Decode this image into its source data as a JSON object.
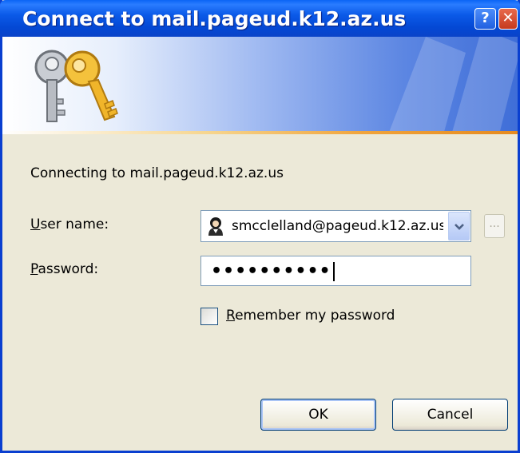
{
  "window": {
    "title": "Connect to mail.pageud.k12.az.us",
    "help_button": "?",
    "close_button": "✕"
  },
  "dialog": {
    "connecting_text": "Connecting to mail.pageud.k12.az.us",
    "user_name": {
      "label_access_key": "U",
      "label_rest": "ser name:",
      "value": "smcclelland@pageud.k12.az.us"
    },
    "password": {
      "label_access_key": "P",
      "label_rest": "assword:",
      "masked_value": "••••••••••"
    },
    "browse_button": "...",
    "remember": {
      "label_access_key": "R",
      "label_rest": "emember my password",
      "checked": false
    },
    "ok_label": "OK",
    "cancel_label": "Cancel"
  },
  "colors": {
    "title_bar": "#0b5ae8",
    "dialog_background": "#ece9d8",
    "banner_accent": "#f0a43c"
  }
}
